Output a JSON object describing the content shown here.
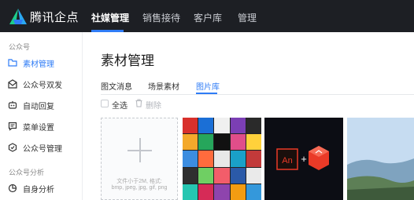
{
  "brand": {
    "name": "腾讯企点"
  },
  "nav": {
    "items": [
      {
        "label": "社媒管理",
        "active": true
      },
      {
        "label": "销售接待"
      },
      {
        "label": "客户库"
      },
      {
        "label": "管理"
      }
    ]
  },
  "sidebar": {
    "group1": "公众号",
    "items": [
      {
        "label": "素材管理",
        "icon": "folder-icon",
        "active": true
      },
      {
        "label": "公众号双发",
        "icon": "send-icon"
      },
      {
        "label": "自动回复",
        "icon": "robot-icon"
      },
      {
        "label": "菜单设置",
        "icon": "menu-icon"
      },
      {
        "label": "公众号管理",
        "icon": "gear-icon"
      }
    ],
    "group2": "公众号分析",
    "items2": [
      {
        "label": "自身分析",
        "icon": "analytics-icon"
      }
    ]
  },
  "main": {
    "title": "素材管理",
    "tabs": [
      {
        "label": "图文消息"
      },
      {
        "label": "场景素材"
      },
      {
        "label": "图片库",
        "active": true
      }
    ],
    "toolbar": {
      "select_all": "全选",
      "delete": "删除"
    },
    "upload": {
      "hint_line1": "文件小于2M, 格式:",
      "hint_line2": "bmp, jpeg, jpg, gif, png"
    },
    "thumb2_text": "An"
  },
  "colors": {
    "accent": "#2f7cf6",
    "topbar": "#1d1f24",
    "adobe_red": "#ea3a27"
  }
}
